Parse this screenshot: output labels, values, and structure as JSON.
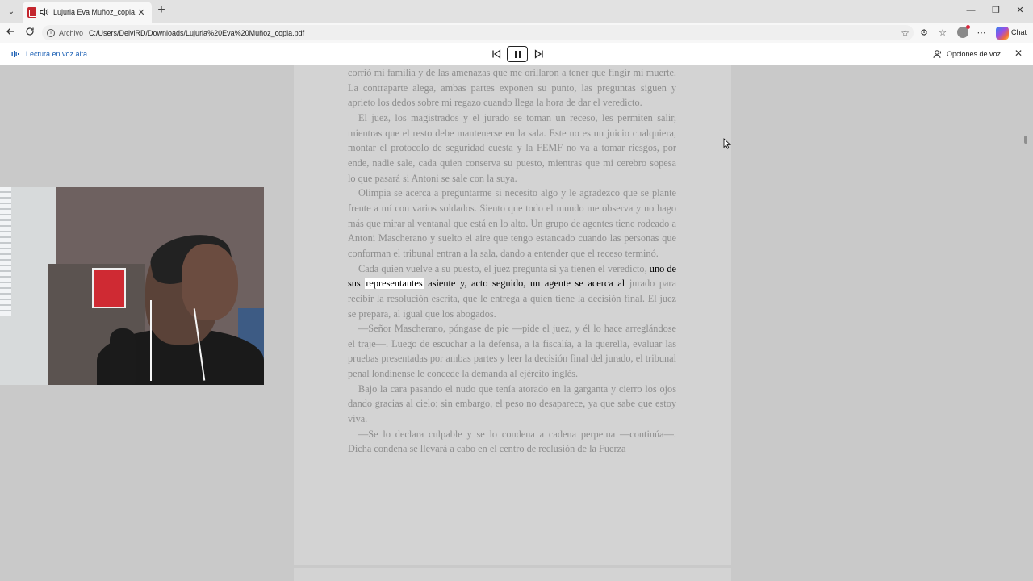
{
  "tab": {
    "title": "Lujuria Eva Muñoz_copia.pdf",
    "close_glyph": "✕",
    "new_tab_glyph": "+"
  },
  "window": {
    "minimize_glyph": "—",
    "restore_glyph": "❐",
    "close_glyph": "✕"
  },
  "address_bar": {
    "scheme_label": "Archivo",
    "url": "C:/Users/DeiviRD/Downloads/Lujuria%20Eva%20Muñoz_copia.pdf"
  },
  "toolbar": {
    "chat_label": "Chat"
  },
  "read_aloud": {
    "label": "Lectura en voz alta",
    "voice_options_label": "Opciones de voz",
    "state": "playing"
  },
  "document": {
    "paragraphs": [
      "corrió mi familia y de las amenazas que me orillaron a tener que fingir mi muerte. La contraparte alega, ambas partes exponen su punto, las preguntas siguen y aprieto los dedos sobre mi regazo cuando llega la hora de dar el veredicto.",
      "El juez, los magistrados y el jurado se toman un receso, les permiten salir, mientras que el resto debe mantenerse en la sala. Este no es un juicio cualquiera, montar el protocolo de seguridad cuesta y la FEMF no va a tomar riesgos, por ende, nadie sale, cada quien conserva su puesto, mientras que mi cerebro sopesa lo que pasará si Antoni se sale con la suya.",
      "Olimpia se acerca a preguntarme si necesito algo y le agradezco que se plante frente a mí con varios soldados. Siento que todo el mundo me observa y no hago más que mirar al ventanal que está en lo alto. Un grupo de agentes tiene rodeado a Antoni Mascherano y suelto el aire que tengo estancado cuando las personas que conforman el tribunal entran a la sala, dando a entender que el receso terminó."
    ],
    "para4": {
      "before": "Cada quien vuelve a su puesto, el juez pregunta si ya tienen el veredicto, ",
      "current_before": "uno de sus ",
      "highlight_word": "representantes",
      "current_after": " asiente y, acto seguido, un agente se acerca al",
      "after": " jurado para recibir la resolución escrita, que le entrega a quien tiene la decisión final. El juez se prepara, al igual que los abogados."
    },
    "paragraphs_after": [
      "—Señor Mascherano, póngase de pie —pide el juez, y él lo hace arreglándose el traje—. Luego de escuchar a la defensa, a la fiscalía, a la querella, evaluar las pruebas presentadas por ambas partes y leer la decisión final del jurado, el tribunal penal londinense le concede la demanda al ejército inglés.",
      "Bajo la cara pasando el nudo que tenía atorado en la garganta y cierro los ojos dando gracias al cielo; sin embargo, el peso no desaparece, ya que sabe que estoy viva.",
      "—Se lo declara culpable y se lo condena a cadena perpetua —continúa—. Dicha condena se llevará a cabo en el centro de reclusión de la Fuerza"
    ]
  },
  "icons": {
    "tab_list": "chevron-down-icon",
    "pdf": "pdf-file-icon",
    "audio": "speaker-icon",
    "back": "arrow-left-icon",
    "refresh": "refresh-icon",
    "info": "info-icon",
    "favorite": "star-icon",
    "extensions": "extensions-icon",
    "favorites": "favorites-icon",
    "profile": "avatar",
    "more": "more-icon",
    "copilot": "copilot-icon"
  }
}
